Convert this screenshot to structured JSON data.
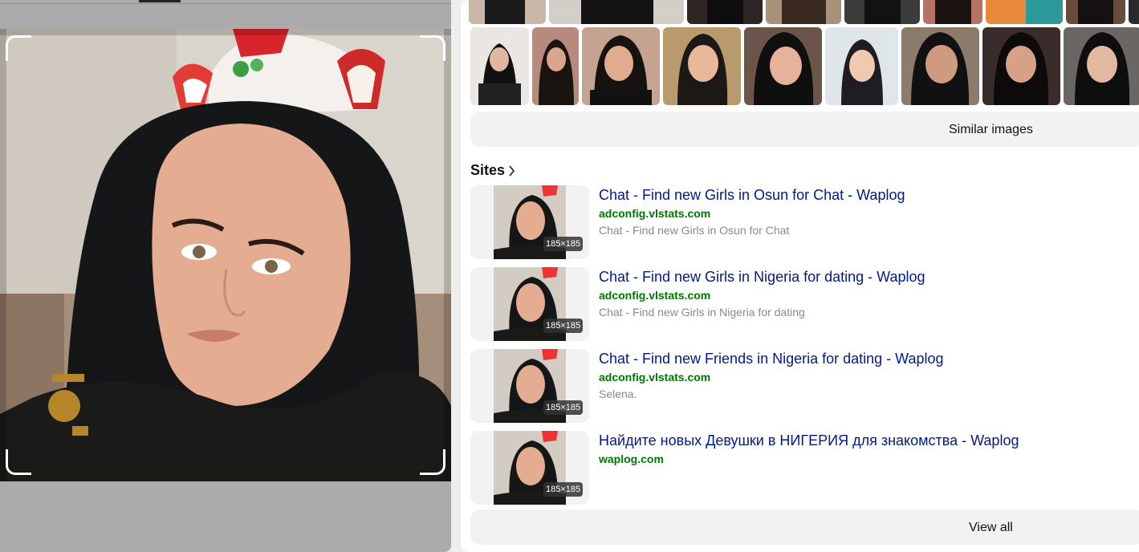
{
  "preview": {
    "image_description_icon": "portrait-photo"
  },
  "similar_images": {
    "button_label": "Similar images"
  },
  "sites": {
    "heading": "Sites",
    "items": [
      {
        "title": "Chat - Find new Girls in Osun for Chat - Waplog",
        "domain": "adconfig.vlstats.com",
        "description": "Chat - Find new Girls in Osun for Chat",
        "size": "185×185"
      },
      {
        "title": "Chat - Find new Girls in Nigeria for dating - Waplog",
        "domain": "adconfig.vlstats.com",
        "description": "Chat - Find new Girls in Nigeria for dating",
        "size": "185×185"
      },
      {
        "title": "Chat - Find new Friends in Nigeria for dating - Waplog",
        "domain": "adconfig.vlstats.com",
        "description": "Selena.",
        "size": "185×185"
      },
      {
        "title": "Найдите новых Девушки в НИГЕРИЯ для знакомства - Waplog",
        "domain": "waplog.com",
        "description": "",
        "size": "185×185"
      }
    ]
  },
  "view_all": {
    "button_label": "View all"
  },
  "colors": {
    "link": "#001a8a",
    "domain": "#007700",
    "muted": "#8a8a8a",
    "button_bg": "#f2f2f3"
  }
}
